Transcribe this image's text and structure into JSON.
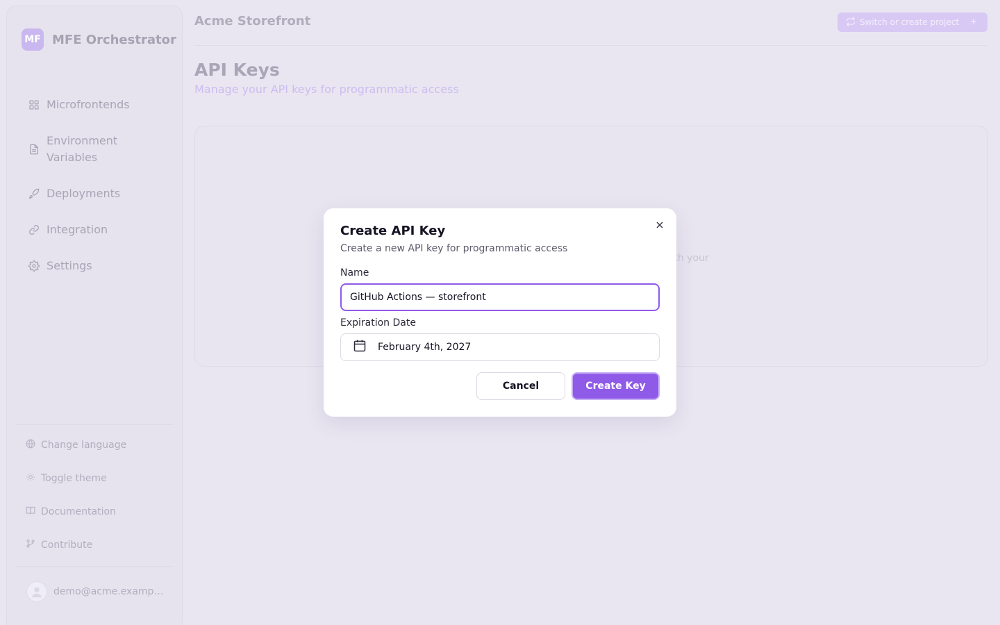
{
  "sidebar": {
    "brand": {
      "logo_text": "MF",
      "name": "MFE Orchestrator"
    },
    "nav": [
      {
        "label": "Microfrontends",
        "icon": "grid-icon"
      },
      {
        "label": "Environment Variables",
        "icon": "file-text-icon"
      },
      {
        "label": "Deployments",
        "icon": "rocket-icon"
      },
      {
        "label": "Integration",
        "icon": "link-icon"
      },
      {
        "label": "Settings",
        "icon": "gear-icon"
      }
    ],
    "utilities": [
      {
        "label": "Change language",
        "icon": "globe-icon"
      },
      {
        "label": "Toggle theme",
        "icon": "sun-icon"
      },
      {
        "label": "Documentation",
        "icon": "book-icon"
      },
      {
        "label": "Contribute",
        "icon": "git-branch-icon"
      }
    ],
    "user": {
      "email": "demo@acme.example.com"
    }
  },
  "header": {
    "project_name": "Acme Storefront",
    "project_button": "Switch or create project"
  },
  "page": {
    "title": "API Keys",
    "subtitle": "Manage your API keys for programmatic access",
    "empty_state_fragment": "with your"
  },
  "modal": {
    "title": "Create API Key",
    "description": "Create a new API key for programmatic access",
    "name_label": "Name",
    "name_value": "GitHub Actions — storefront",
    "expiration_label": "Expiration Date",
    "expiration_value": "February 4th, 2027",
    "cancel_label": "Cancel",
    "create_label": "Create Key"
  },
  "colors": {
    "accent": "#8f5ae8",
    "backdrop": "#e9e6f1",
    "text_primary": "#161324"
  }
}
